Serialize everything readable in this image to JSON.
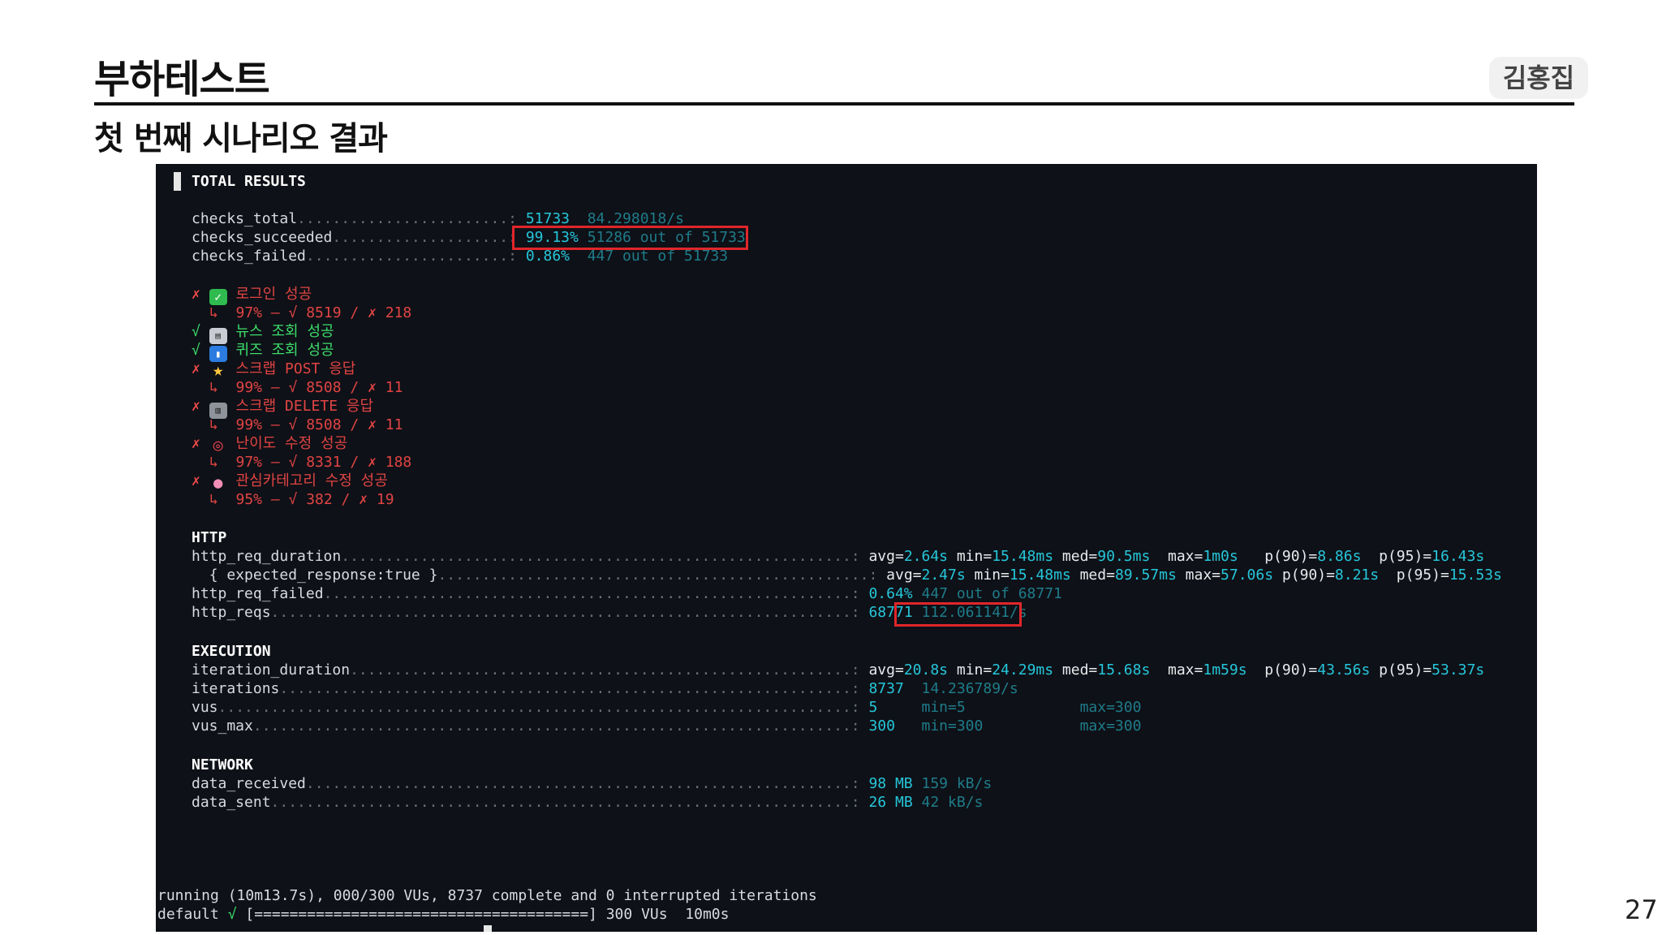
{
  "slide": {
    "title": "부하테스트",
    "subtitle": "첫 번째 시나리오 결과",
    "author": "김홍집",
    "page_number": "27"
  },
  "terminal": {
    "header": "TOTAL RESULTS",
    "checks": [
      {
        "name": "checks_total",
        "dots": "........................",
        "value": "51733",
        "detail": "84.298018/s"
      },
      {
        "name": "checks_succeeded",
        "dots": "....................",
        "value": "99.13%",
        "detail": "51286 out of 51733"
      },
      {
        "name": "checks_failed",
        "dots": ".......................",
        "value": "0.86%",
        "detail": "447 out of 51733"
      }
    ],
    "check_items": [
      {
        "mark": "✗",
        "emoji": "✓",
        "label": "로그인 성공",
        "sub": "↳  97% — √ 8519 / ✗ 218"
      },
      {
        "mark": "√",
        "emoji": "▤",
        "label": "뉴스 조회 성공",
        "sub": ""
      },
      {
        "mark": "√",
        "emoji": "▮",
        "label": "퀴즈 조회 성공",
        "sub": ""
      },
      {
        "mark": "✗",
        "emoji": "★",
        "label": "스크랩 POST 응답",
        "sub": "↳  99% — √ 8508 / ✗ 11"
      },
      {
        "mark": "✗",
        "emoji": "▥",
        "label": "스크랩 DELETE 응답",
        "sub": "↳  99% — √ 8508 / ✗ 11"
      },
      {
        "mark": "✗",
        "emoji": "◎",
        "label": "난이도 수정 성공",
        "sub": "↳  97% — √ 8331 / ✗ 188"
      },
      {
        "mark": "✗",
        "emoji": "●",
        "label": "관심카테고리 수정 성공",
        "sub": "↳  95% — √ 382 / ✗ 19"
      }
    ],
    "http": {
      "header": "HTTP",
      "req_duration": {
        "name": "http_req_duration",
        "avg": "2.64s",
        "min": "15.48ms",
        "med": "90.5ms",
        "max": "1m0s",
        "p90": "8.86s",
        "p95": "16.43s"
      },
      "expected": {
        "name": "{ expected_response:true }",
        "avg": "2.47s",
        "min": "15.48ms",
        "med": "89.57ms",
        "max": "57.06s",
        "p90": "8.21s",
        "p95": "15.53s"
      },
      "req_failed": {
        "name": "http_req_failed",
        "value": "0.64%",
        "detail": "447 out of 68771"
      },
      "reqs": {
        "name": "http_reqs",
        "value": "68771",
        "detail": "112.061141/s"
      }
    },
    "execution": {
      "header": "EXECUTION",
      "iteration_duration": {
        "name": "iteration_duration",
        "avg": "20.8s",
        "min": "24.29ms",
        "med": "15.68s",
        "max": "1m59s",
        "p90": "43.56s",
        "p95": "53.37s"
      },
      "iterations": {
        "name": "iterations",
        "value": "8737",
        "detail": "14.236789/s"
      },
      "vus": {
        "name": "vus",
        "value": "5",
        "min": "min=5",
        "max": "max=300"
      },
      "vus_max": {
        "name": "vus_max",
        "value": "300",
        "min": "min=300",
        "max": "max=300"
      }
    },
    "network": {
      "header": "NETWORK",
      "data_received": {
        "name": "data_received",
        "value": "98 MB",
        "detail": "159 kB/s"
      },
      "data_sent": {
        "name": "data_sent",
        "value": "26 MB",
        "detail": "42 kB/s"
      }
    },
    "status": {
      "running": "running (10m13.7s), 000/300 VUs, 8737 complete and 0 interrupted iterations",
      "default_label": "default",
      "check": "√",
      "progress": "[======================================]",
      "vus": "300 VUs",
      "duration": "10m0s"
    }
  }
}
